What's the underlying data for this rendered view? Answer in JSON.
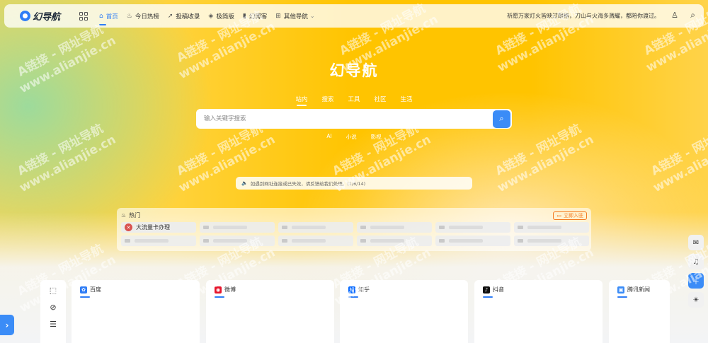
{
  "header": {
    "logo_text": "幻导航",
    "nav": [
      {
        "icon": "home-icon",
        "glyph": "⌂",
        "label": "首页"
      },
      {
        "icon": "fire-icon",
        "glyph": "♨",
        "label": "今日热榜"
      },
      {
        "icon": "send-icon",
        "glyph": "➚",
        "label": "投稿收录"
      },
      {
        "icon": "layers-icon",
        "glyph": "◈",
        "label": "极简版"
      },
      {
        "icon": "book-icon",
        "glyph": "▮",
        "label": "幻博客"
      },
      {
        "icon": "grid-icon",
        "glyph": "⊞",
        "label": "其他导航"
      }
    ],
    "notice": "祈愿万家灯火皆映过眼格，刀山与火海多溅耀，都陪你渡过。"
  },
  "hero": {
    "title": "幻导航",
    "tabs": [
      "站内",
      "搜索",
      "工具",
      "社区",
      "生活"
    ],
    "search_placeholder": "输入关键字搜索",
    "subtabs": [
      "AI",
      "小说",
      "影视"
    ],
    "notice_bar": "如遇到网址连接或已失效，请反馈给我们处理。(1/6/14)"
  },
  "hot": {
    "title": "热门",
    "join_label": "立即入驻",
    "first_item": "大流量卡办理"
  },
  "cards": [
    {
      "title": "百度",
      "color": "#2f7df6",
      "glyph": "✿"
    },
    {
      "title": "微博",
      "color": "#e6162d",
      "glyph": "◉"
    },
    {
      "title": "知乎",
      "color": "#0066ff",
      "glyph": "知"
    },
    {
      "title": "抖音",
      "color": "#111111",
      "glyph": "♪"
    },
    {
      "title": "腾讯新闻",
      "color": "#3b8cf7",
      "glyph": "▣"
    }
  ],
  "watermark": {
    "line1": "A链接 - 网址导航",
    "line2": "www.alianjie.cn"
  }
}
